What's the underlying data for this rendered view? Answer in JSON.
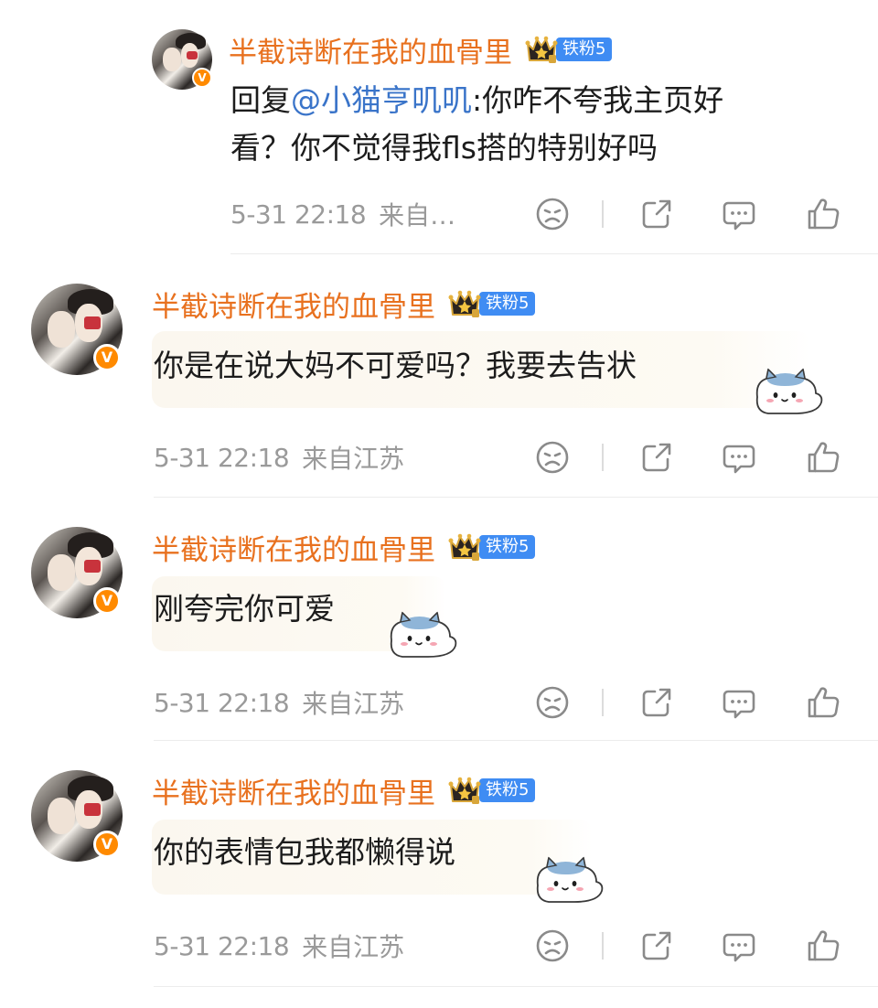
{
  "comments": [
    {
      "username": "半截诗断在我的血骨里",
      "fan_badge": "铁粉5",
      "text_prefix": "回复",
      "mention": "@小猫亨叽叽",
      "text_line1": ":你咋不夸我主页好",
      "text_line2": "看？你不觉得我fls搭的特别好吗",
      "time": "5-31 22:18",
      "location": "来自…",
      "has_sticker": false
    },
    {
      "username": "半截诗断在我的血骨里",
      "fan_badge": "铁粉5",
      "text": "你是在说大妈不可爱吗？我要去告状",
      "time": "5-31 22:18",
      "location": "来自江苏",
      "has_sticker": true
    },
    {
      "username": "半截诗断在我的血骨里",
      "fan_badge": "铁粉5",
      "text": "刚夸完你可爱",
      "time": "5-31 22:18",
      "location": "来自江苏",
      "has_sticker": true
    },
    {
      "username": "半截诗断在我的血骨里",
      "fan_badge": "铁粉5",
      "text": "你的表情包我都懒得说",
      "time": "5-31 22:18",
      "location": "来自江苏",
      "has_sticker": true
    }
  ],
  "verified_badge": "V",
  "icons": [
    "sad-face-icon",
    "share-icon",
    "comment-icon",
    "like-icon"
  ],
  "colors": {
    "username": "#e8711f",
    "mention": "#3a74c9",
    "fan_badge": "#3f8cf3",
    "meta": "#9a9a9a"
  }
}
